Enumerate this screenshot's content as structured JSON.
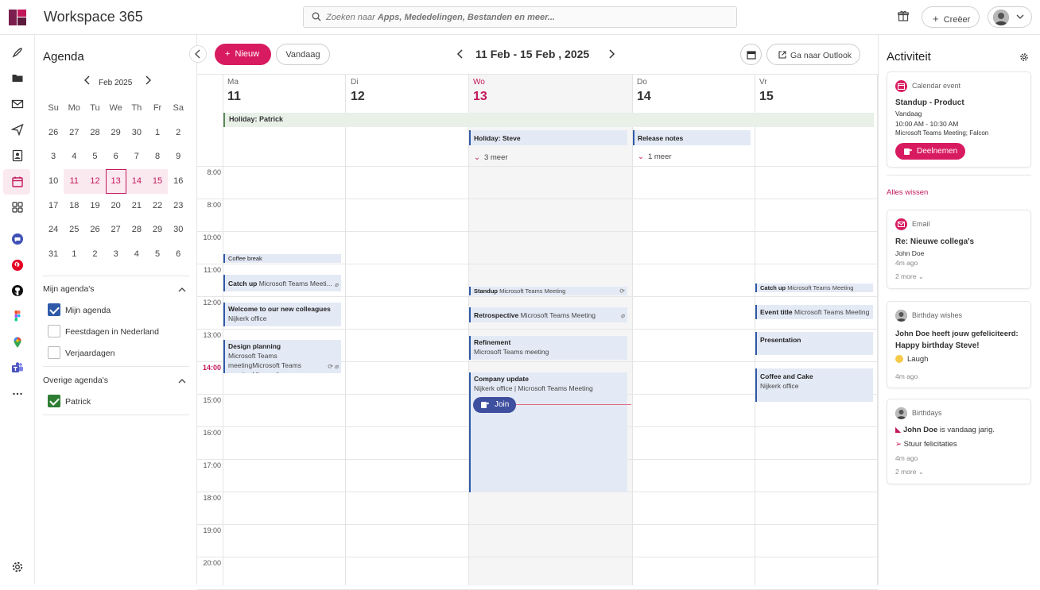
{
  "app": {
    "title": "Workspace 365"
  },
  "search": {
    "placeholder_prefix": "Zoeken naar ",
    "placeholder_rest": "Apps, Mededelingen, Bestanden en meer..."
  },
  "header": {
    "create_label": "Creëer"
  },
  "colors": {
    "accent": "#d81b60",
    "event_blue": "#2f5aa8",
    "event_bg": "#e4eaf5",
    "allday_green": "#e8f0e8"
  },
  "rail_icons": [
    "rocket-icon",
    "folder-icon",
    "mail-icon",
    "send-icon",
    "contacts-icon",
    "calendar-icon",
    "apps-grid-icon",
    "chat-icon",
    "pinterest-icon",
    "github-icon",
    "figma-icon",
    "maps-icon",
    "teams-icon",
    "more-icon",
    "settings-icon"
  ],
  "agenda": {
    "title": "Agenda",
    "month_label": "Feb 2025",
    "weekdays": [
      "Su",
      "Mo",
      "Tu",
      "We",
      "Th",
      "Fr",
      "Sa"
    ],
    "weeks": [
      [
        "26",
        "27",
        "28",
        "29",
        "30",
        "1",
        "2"
      ],
      [
        "3",
        "4",
        "5",
        "6",
        "7",
        "8",
        "9"
      ],
      [
        "10",
        "11",
        "12",
        "13",
        "14",
        "15",
        "16"
      ],
      [
        "17",
        "18",
        "19",
        "20",
        "21",
        "22",
        "23"
      ],
      [
        "24",
        "25",
        "26",
        "27",
        "28",
        "29",
        "30"
      ],
      [
        "31",
        "1",
        "2",
        "3",
        "4",
        "5",
        "6"
      ]
    ],
    "my_calendars_title": "Mijn agenda's",
    "my_calendars": [
      {
        "label": "Mijn agenda",
        "checked": true
      },
      {
        "label": "Feestdagen in Nederland",
        "checked": false
      },
      {
        "label": "Verjaardagen",
        "checked": false
      }
    ],
    "other_calendars_title": "Overige agenda's",
    "other_calendars": [
      {
        "label": "Patrick",
        "checked": true
      }
    ]
  },
  "toolbar": {
    "new_label": "Nieuw",
    "today_label": "Vandaag",
    "week_title": "11 Feb - 15 Feb , 2025",
    "outlook_label": "Ga naar Outlook"
  },
  "days": [
    {
      "name": "Ma",
      "date": "11"
    },
    {
      "name": "Di",
      "date": "12"
    },
    {
      "name": "Wo",
      "date": "13"
    },
    {
      "name": "Do",
      "date": "14"
    },
    {
      "name": "Vr",
      "date": "15"
    }
  ],
  "times": [
    "8:00",
    "8:00",
    "10:00",
    "11:00",
    "12:00",
    "13:00",
    "14:00",
    "15:00",
    "16:00",
    "17:00",
    "18:00",
    "19:00",
    "20:00"
  ],
  "allday": {
    "holiday_patrick": "Holiday: Patrick",
    "holiday_steve": "Holiday: Steve",
    "release_notes": "Release notes",
    "more_wed": "3 meer",
    "more_thu": "1 meer"
  },
  "events": {
    "coffee_break": {
      "title": "Coffee break"
    },
    "catchup_mon": {
      "title": "Catch up",
      "sub": "Microsoft Teams Meeti..."
    },
    "welcome": {
      "title": "Welcome to our new colleagues",
      "sub": "Nijkerk office"
    },
    "design": {
      "title": "Design planning",
      "sub": "Microsoft Teams meetingMicrosoft Teams meetingMicrosoft..."
    },
    "standup": {
      "title": "Standup",
      "sub": "Microsoft Teams Meeting"
    },
    "retro": {
      "title": "Retrospective",
      "sub": "Microsoft Teams Meeting"
    },
    "refinement": {
      "title": "Refinement",
      "sub": "Microsoft Teams meeting"
    },
    "company": {
      "title": "Company update",
      "sub": "Nijkerk office | Microsoft Teams Meeting",
      "join": "Join"
    },
    "catchup_fri": {
      "title": "Catch up",
      "sub": "Microsoft Teams Meeting"
    },
    "event_title": {
      "title": "Event title",
      "sub": "Microsoft Teams Meeting"
    },
    "presentation": {
      "title": "Presentation"
    },
    "coffee_cake": {
      "title": "Coffee and Cake",
      "sub": "Nijkerk office"
    }
  },
  "activity": {
    "title": "Activiteit",
    "clear_label": "Alles wissen",
    "cards": {
      "calendar": {
        "type": "Calendar event",
        "title": "Standup - Product",
        "day": "Vandaag",
        "time": "10:00 AM - 10:30 AM",
        "detail": "Microsoft Teams Meeting; Falcon",
        "action": "Deelnemen"
      },
      "email": {
        "type": "Email",
        "title": "Re: Nieuwe collega's",
        "from": "John Doe",
        "age": "4m ago",
        "more": "2 more"
      },
      "wishes": {
        "type": "Birthday wishes",
        "line1": "John Doe heeft jouw gefeliciteerd:",
        "line2": "Happy birthday Steve!",
        "reaction": "Laugh",
        "age": "4m ago"
      },
      "birthdays": {
        "type": "Birthdays",
        "name": "John Doe",
        "rest": " is vandaag jarig.",
        "action": "Stuur felicitaties",
        "age": "4m ago",
        "more": "2 more"
      }
    }
  }
}
